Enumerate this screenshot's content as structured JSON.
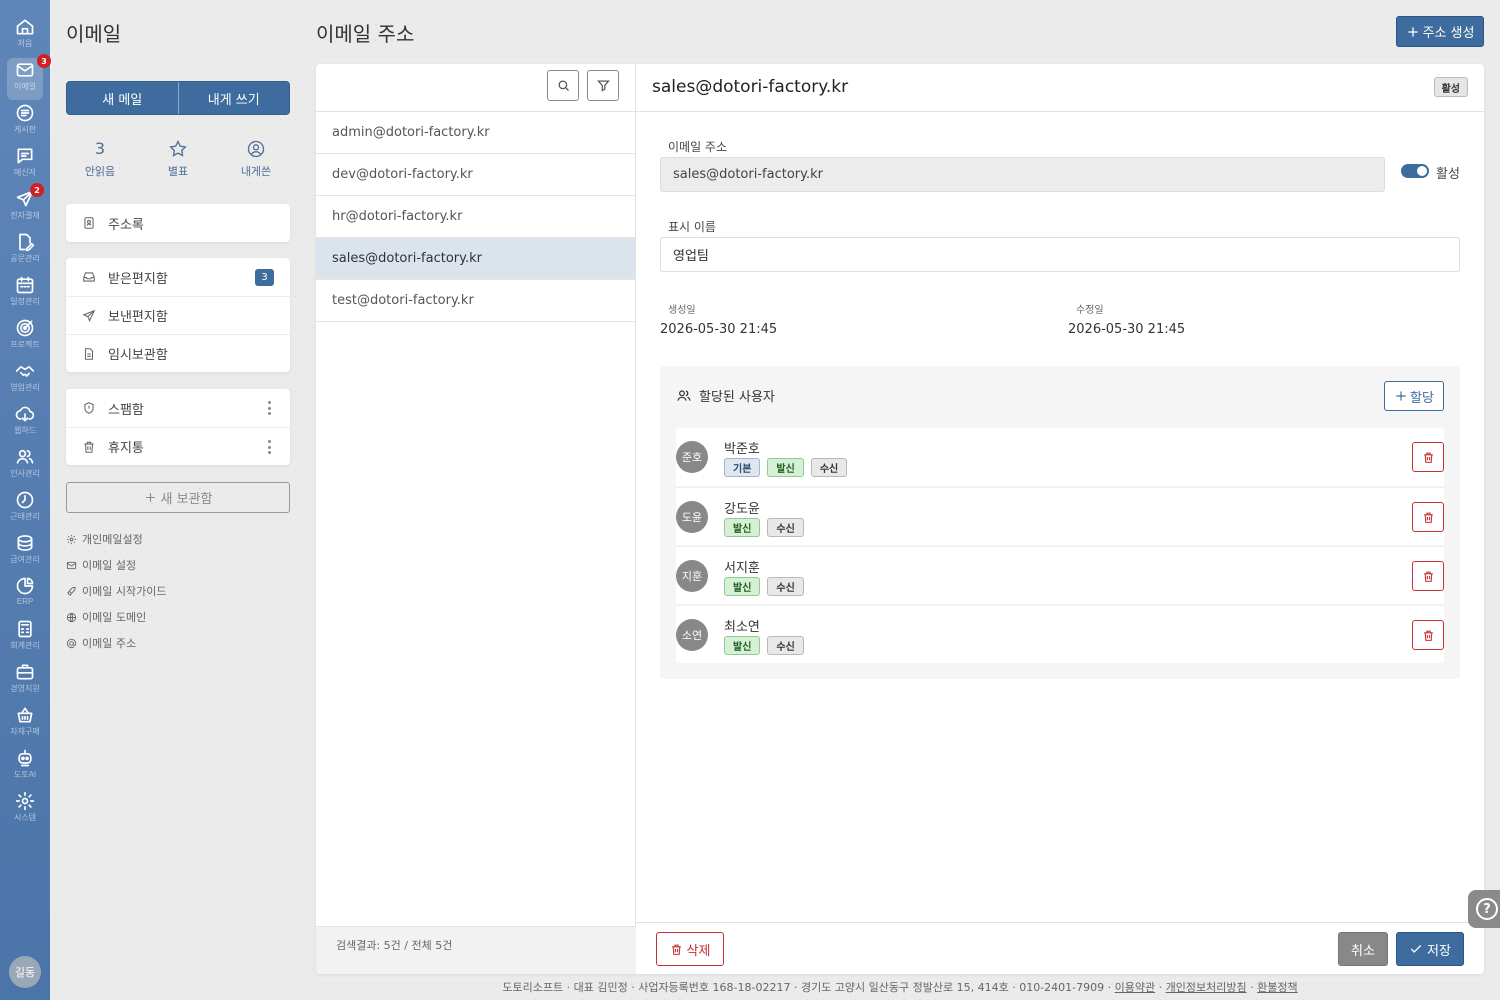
{
  "rail": {
    "items": [
      {
        "label": "처음",
        "icon": "home-icon"
      },
      {
        "label": "이메일",
        "icon": "mail-icon",
        "badge": "3",
        "active": true
      },
      {
        "label": "게시판",
        "icon": "board-icon"
      },
      {
        "label": "메신저",
        "icon": "chat-icon"
      },
      {
        "label": "전자결재",
        "icon": "send-icon",
        "badge": "2"
      },
      {
        "label": "공문관리",
        "icon": "document-edit-icon"
      },
      {
        "label": "일정관리",
        "icon": "calendar-icon"
      },
      {
        "label": "프로젝트",
        "icon": "target-icon"
      },
      {
        "label": "영업관리",
        "icon": "handshake-icon"
      },
      {
        "label": "웹하드",
        "icon": "cloud-icon"
      },
      {
        "label": "인사관리",
        "icon": "users-icon"
      },
      {
        "label": "근태관리",
        "icon": "clock-icon"
      },
      {
        "label": "급여관리",
        "icon": "coins-icon"
      },
      {
        "label": "ERP",
        "icon": "pie-chart-icon"
      },
      {
        "label": "회계관리",
        "icon": "calculator-icon"
      },
      {
        "label": "경영지원",
        "icon": "briefcase-icon"
      },
      {
        "label": "자재구매",
        "icon": "basket-icon"
      },
      {
        "label": "도토AI",
        "icon": "robot-icon"
      },
      {
        "label": "시스템",
        "icon": "gear-icon"
      }
    ],
    "avatar": "길동"
  },
  "side": {
    "title": "이메일",
    "new_mail": "새 메일",
    "write_self": "내게 쓰기",
    "stats": [
      {
        "value": "3",
        "label": "안읽음"
      },
      {
        "label": "별표",
        "icon": "star-icon"
      },
      {
        "label": "내게쓴",
        "icon": "user-circle-icon"
      }
    ],
    "address_book": "주소록",
    "folders": [
      {
        "label": "받은편지함",
        "badge": "3",
        "icon": "inbox-icon"
      },
      {
        "label": "보낸편지함",
        "icon": "send-icon"
      },
      {
        "label": "임시보관함",
        "icon": "draft-icon"
      }
    ],
    "extra_folders": [
      {
        "label": "스팸함",
        "icon": "shield-icon"
      },
      {
        "label": "휴지통",
        "icon": "trash-icon"
      }
    ],
    "new_folder": "새 보관함",
    "links": [
      {
        "label": "개인메일설정",
        "icon": "gear-icon"
      },
      {
        "label": "이메일 설정",
        "icon": "mail-icon"
      },
      {
        "label": "이메일 시작가이드",
        "icon": "rocket-icon"
      },
      {
        "label": "이메일 도메인",
        "icon": "globe-icon"
      },
      {
        "label": "이메일 주소",
        "icon": "at-icon"
      }
    ]
  },
  "page": {
    "title": "이메일 주소",
    "create_button": "주소 생성"
  },
  "list": {
    "items": [
      "admin@dotori-factory.kr",
      "dev@dotori-factory.kr",
      "hr@dotori-factory.kr",
      "sales@dotori-factory.kr",
      "test@dotori-factory.kr"
    ],
    "selected_index": 3,
    "footer": "검색결과: 5건 / 전체 5건"
  },
  "detail": {
    "title": "sales@dotori-factory.kr",
    "status_badge": "활성",
    "email_label": "이메일 주소",
    "email_value": "sales@dotori-factory.kr",
    "active_label": "활성",
    "active": true,
    "display_name_label": "표시 이름",
    "display_name_value": "영업팀",
    "created_label": "생성일",
    "created_value": "2026-05-30 21:45",
    "modified_label": "수정일",
    "modified_value": "2026-05-30 21:45",
    "users_title": "할당된 사용자",
    "assign_button": "할당",
    "users": [
      {
        "avatar": "준호",
        "name": "박준호",
        "tags": [
          "기본",
          "발신",
          "수신"
        ]
      },
      {
        "avatar": "도윤",
        "name": "강도윤",
        "tags": [
          "발신",
          "수신"
        ]
      },
      {
        "avatar": "지훈",
        "name": "서지훈",
        "tags": [
          "발신",
          "수신"
        ]
      },
      {
        "avatar": "소연",
        "name": "최소연",
        "tags": [
          "발신",
          "수신"
        ]
      }
    ],
    "delete_button": "삭제",
    "cancel_button": "취소",
    "save_button": "저장"
  },
  "footer": {
    "text": "도토리소프트 · 대표 김민정 · 사업자등록번호 168-18-02217 · 경기도 고양시 일산동구 정발산로 15, 414호 · 010-2401-7909",
    "links": [
      "이용약관",
      "개인정보처리방침",
      "환불정책"
    ]
  },
  "help": "?"
}
